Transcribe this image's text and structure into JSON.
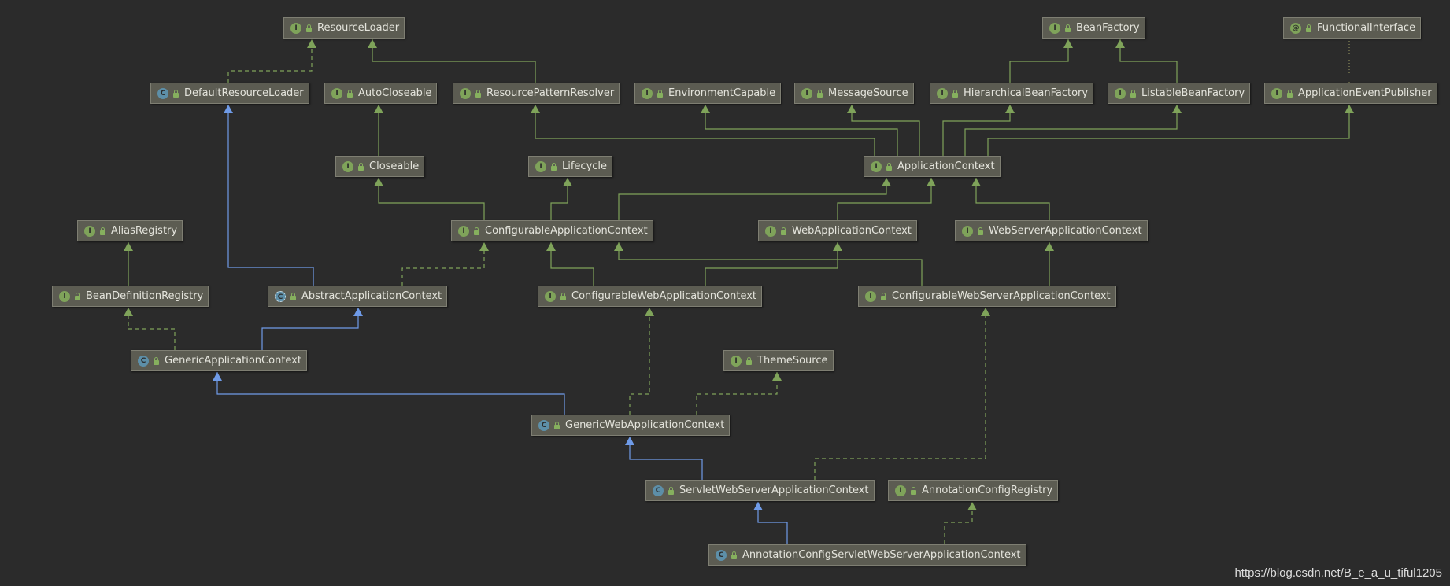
{
  "diagram": {
    "nodes": [
      {
        "id": "ResourceLoader",
        "label": "ResourceLoader",
        "kind": "interface",
        "icon": "interface-icon"
      },
      {
        "id": "BeanFactory",
        "label": "BeanFactory",
        "kind": "interface",
        "icon": "interface-icon"
      },
      {
        "id": "FunctionalInterface",
        "label": "FunctionalInterface",
        "kind": "annotation",
        "icon": "annotation-icon"
      },
      {
        "id": "DefaultResourceLoader",
        "label": "DefaultResourceLoader",
        "kind": "class",
        "icon": "class-icon"
      },
      {
        "id": "AutoCloseable",
        "label": "AutoCloseable",
        "kind": "interface",
        "icon": "interface-icon"
      },
      {
        "id": "ResourcePatternResolver",
        "label": "ResourcePatternResolver",
        "kind": "interface",
        "icon": "interface-icon"
      },
      {
        "id": "EnvironmentCapable",
        "label": "EnvironmentCapable",
        "kind": "interface",
        "icon": "interface-icon"
      },
      {
        "id": "MessageSource",
        "label": "MessageSource",
        "kind": "interface",
        "icon": "interface-icon"
      },
      {
        "id": "HierarchicalBeanFactory",
        "label": "HierarchicalBeanFactory",
        "kind": "interface",
        "icon": "interface-icon"
      },
      {
        "id": "ListableBeanFactory",
        "label": "ListableBeanFactory",
        "kind": "interface",
        "icon": "interface-icon"
      },
      {
        "id": "ApplicationEventPublisher",
        "label": "ApplicationEventPublisher",
        "kind": "interface",
        "icon": "interface-icon"
      },
      {
        "id": "Closeable",
        "label": "Closeable",
        "kind": "interface",
        "icon": "interface-icon"
      },
      {
        "id": "Lifecycle",
        "label": "Lifecycle",
        "kind": "interface",
        "icon": "interface-icon"
      },
      {
        "id": "ApplicationContext",
        "label": "ApplicationContext",
        "kind": "interface",
        "icon": "interface-icon"
      },
      {
        "id": "AliasRegistry",
        "label": "AliasRegistry",
        "kind": "interface",
        "icon": "interface-icon"
      },
      {
        "id": "ConfigurableApplicationContext",
        "label": "ConfigurableApplicationContext",
        "kind": "interface",
        "icon": "interface-icon"
      },
      {
        "id": "WebApplicationContext",
        "label": "WebApplicationContext",
        "kind": "interface",
        "icon": "interface-icon"
      },
      {
        "id": "WebServerApplicationContext",
        "label": "WebServerApplicationContext",
        "kind": "interface",
        "icon": "interface-icon"
      },
      {
        "id": "BeanDefinitionRegistry",
        "label": "BeanDefinitionRegistry",
        "kind": "interface",
        "icon": "interface-icon"
      },
      {
        "id": "AbstractApplicationContext",
        "label": "AbstractApplicationContext",
        "kind": "abstract-class",
        "icon": "abstract-class-icon"
      },
      {
        "id": "ConfigurableWebApplicationContext",
        "label": "ConfigurableWebApplicationContext",
        "kind": "interface",
        "icon": "interface-icon"
      },
      {
        "id": "ConfigurableWebServerApplicationContext",
        "label": "ConfigurableWebServerApplicationContext",
        "kind": "interface",
        "icon": "interface-icon"
      },
      {
        "id": "GenericApplicationContext",
        "label": "GenericApplicationContext",
        "kind": "class",
        "icon": "class-icon"
      },
      {
        "id": "ThemeSource",
        "label": "ThemeSource",
        "kind": "interface",
        "icon": "interface-icon"
      },
      {
        "id": "GenericWebApplicationContext",
        "label": "GenericWebApplicationContext",
        "kind": "class",
        "icon": "class-icon"
      },
      {
        "id": "ServletWebServerApplicationContext",
        "label": "ServletWebServerApplicationContext",
        "kind": "class",
        "icon": "class-icon"
      },
      {
        "id": "AnnotationConfigRegistry",
        "label": "AnnotationConfigRegistry",
        "kind": "interface",
        "icon": "interface-icon"
      },
      {
        "id": "AnnotationConfigServletWebServerApplicationContext",
        "label": "AnnotationConfigServletWebServerApplicationContext",
        "kind": "class",
        "icon": "class-icon"
      }
    ],
    "edges": [
      {
        "from": "DefaultResourceLoader",
        "to": "ResourceLoader",
        "type": "implements"
      },
      {
        "from": "ResourcePatternResolver",
        "to": "ResourceLoader",
        "type": "extends-interface"
      },
      {
        "from": "HierarchicalBeanFactory",
        "to": "BeanFactory",
        "type": "extends-interface"
      },
      {
        "from": "ListableBeanFactory",
        "to": "BeanFactory",
        "type": "extends-interface"
      },
      {
        "from": "ApplicationEventPublisher",
        "to": "FunctionalInterface",
        "type": "annotated"
      },
      {
        "from": "Closeable",
        "to": "AutoCloseable",
        "type": "extends-interface"
      },
      {
        "from": "ApplicationContext",
        "to": "ResourcePatternResolver",
        "type": "extends-interface"
      },
      {
        "from": "ApplicationContext",
        "to": "EnvironmentCapable",
        "type": "extends-interface"
      },
      {
        "from": "ApplicationContext",
        "to": "MessageSource",
        "type": "extends-interface"
      },
      {
        "from": "ApplicationContext",
        "to": "HierarchicalBeanFactory",
        "type": "extends-interface"
      },
      {
        "from": "ApplicationContext",
        "to": "ListableBeanFactory",
        "type": "extends-interface"
      },
      {
        "from": "ApplicationContext",
        "to": "ApplicationEventPublisher",
        "type": "extends-interface"
      },
      {
        "from": "ConfigurableApplicationContext",
        "to": "Closeable",
        "type": "extends-interface"
      },
      {
        "from": "ConfigurableApplicationContext",
        "to": "Lifecycle",
        "type": "extends-interface"
      },
      {
        "from": "ConfigurableApplicationContext",
        "to": "ApplicationContext",
        "type": "extends-interface"
      },
      {
        "from": "WebApplicationContext",
        "to": "ApplicationContext",
        "type": "extends-interface"
      },
      {
        "from": "WebServerApplicationContext",
        "to": "ApplicationContext",
        "type": "extends-interface"
      },
      {
        "from": "BeanDefinitionRegistry",
        "to": "AliasRegistry",
        "type": "extends-interface"
      },
      {
        "from": "AbstractApplicationContext",
        "to": "DefaultResourceLoader",
        "type": "extends-class"
      },
      {
        "from": "AbstractApplicationContext",
        "to": "ConfigurableApplicationContext",
        "type": "implements"
      },
      {
        "from": "ConfigurableWebApplicationContext",
        "to": "ConfigurableApplicationContext",
        "type": "extends-interface"
      },
      {
        "from": "ConfigurableWebApplicationContext",
        "to": "WebApplicationContext",
        "type": "extends-interface"
      },
      {
        "from": "ConfigurableWebServerApplicationContext",
        "to": "ConfigurableApplicationContext",
        "type": "extends-interface"
      },
      {
        "from": "ConfigurableWebServerApplicationContext",
        "to": "WebServerApplicationContext",
        "type": "extends-interface"
      },
      {
        "from": "GenericApplicationContext",
        "to": "BeanDefinitionRegistry",
        "type": "implements"
      },
      {
        "from": "GenericApplicationContext",
        "to": "AbstractApplicationContext",
        "type": "extends-class"
      },
      {
        "from": "GenericWebApplicationContext",
        "to": "GenericApplicationContext",
        "type": "extends-class"
      },
      {
        "from": "GenericWebApplicationContext",
        "to": "ConfigurableWebApplicationContext",
        "type": "implements"
      },
      {
        "from": "GenericWebApplicationContext",
        "to": "ThemeSource",
        "type": "implements"
      },
      {
        "from": "ServletWebServerApplicationContext",
        "to": "GenericWebApplicationContext",
        "type": "extends-class"
      },
      {
        "from": "ServletWebServerApplicationContext",
        "to": "ConfigurableWebServerApplicationContext",
        "type": "implements"
      },
      {
        "from": "AnnotationConfigServletWebServerApplicationContext",
        "to": "ServletWebServerApplicationContext",
        "type": "extends-class"
      },
      {
        "from": "AnnotationConfigServletWebServerApplicationContext",
        "to": "AnnotationConfigRegistry",
        "type": "implements"
      }
    ],
    "colors": {
      "background": "#2b2b2b",
      "node_fill": "#5c5c52",
      "interface_edge": "#7fa35a",
      "class_edge": "#6f9be8",
      "node_text": "#e4e4dc"
    }
  },
  "watermark": "https://blog.csdn.net/B_e_a_u_tiful1205"
}
